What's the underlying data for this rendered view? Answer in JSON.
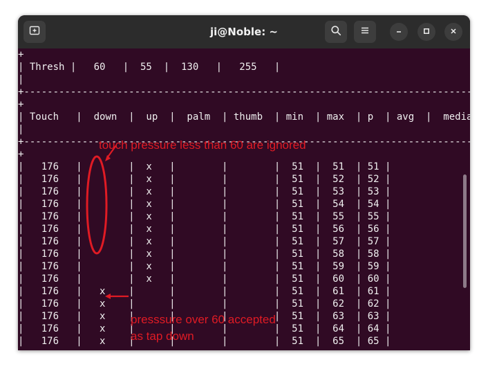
{
  "window": {
    "title": "ji@Noble: ~",
    "icons": [
      "new-tab-icon",
      "search-icon",
      "hamburger-menu-icon",
      "minimize-icon",
      "maximize-icon",
      "close-icon"
    ]
  },
  "terminal": {
    "lines": [
      "+",
      "| Thresh |   60   |  55  |  130   |   255   |",
      "|",
      "+---------------------------------------------------------------------------------",
      "+",
      "| Touch   |  down  |  up  |  palm  | thumb  | min  | max  | p  | avg  |  median",
      "|",
      "+---------------------------------------------------------------------------------",
      "+",
      "|   176   |        |  x   |        |        |  51  |  51  | 51 |",
      "|   176   |        |  x   |        |        |  51  |  52  | 52 |",
      "|   176   |        |  x   |        |        |  51  |  53  | 53 |",
      "|   176   |        |  x   |        |        |  51  |  54  | 54 |",
      "|   176   |        |  x   |        |        |  51  |  55  | 55 |",
      "|   176   |        |  x   |        |        |  51  |  56  | 56 |",
      "|   176   |        |  x   |        |        |  51  |  57  | 57 |",
      "|   176   |        |  x   |        |        |  51  |  58  | 58 |",
      "|   176   |        |  x   |        |        |  51  |  59  | 59 |",
      "|   176   |        |  x   |        |        |  51  |  60  | 60 |",
      "|   176   |   x    |      |        |        |  51  |  61  | 61 |",
      "|   176   |   x    |      |        |        |  51  |  62  | 62 |",
      "|   176   |   x    |      |        |        |  51  |  63  | 63 |",
      "|   176   |   x    |      |        |        |  51  |  64  | 64 |",
      "|   176   |   x    |      |        |        |  51  |  65  | 65 |"
    ]
  },
  "annotations": {
    "ignored": "touch pressure less than 60 are ignored",
    "accepted_line1": "presssure over 60 accepted",
    "accepted_line2": "as tap down",
    "color": "#e01b24"
  },
  "colors": {
    "terminal_bg": "#300a24",
    "titlebar_bg": "#2c2c2c",
    "text": "#f0f0f0"
  }
}
